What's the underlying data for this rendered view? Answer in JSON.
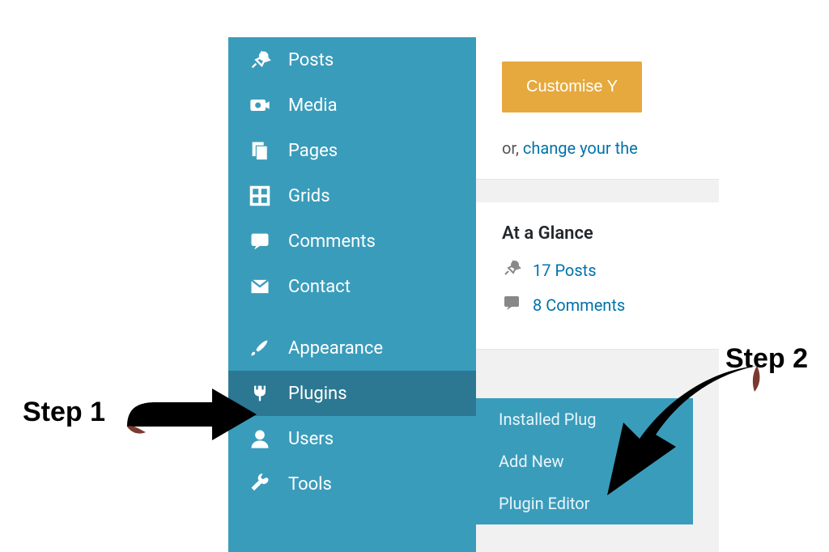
{
  "sidebar": {
    "items": [
      {
        "label": "Posts"
      },
      {
        "label": "Media"
      },
      {
        "label": "Pages"
      },
      {
        "label": "Grids"
      },
      {
        "label": "Comments"
      },
      {
        "label": "Contact"
      },
      {
        "label": "Appearance"
      },
      {
        "label": "Plugins"
      },
      {
        "label": "Users"
      },
      {
        "label": "Tools"
      }
    ]
  },
  "submenu": {
    "items": [
      {
        "label": "Installed Plug"
      },
      {
        "label": "Add New"
      },
      {
        "label": "Plugin Editor"
      }
    ]
  },
  "main": {
    "customise_button": "Customise Y",
    "or_text": "or, ",
    "change_link": "change your the",
    "glance_title": "At a Glance",
    "posts_count": "17 Posts",
    "comments_count": "8 Comments"
  },
  "annotations": {
    "step1": "Step 1",
    "step2": "Step 2"
  }
}
